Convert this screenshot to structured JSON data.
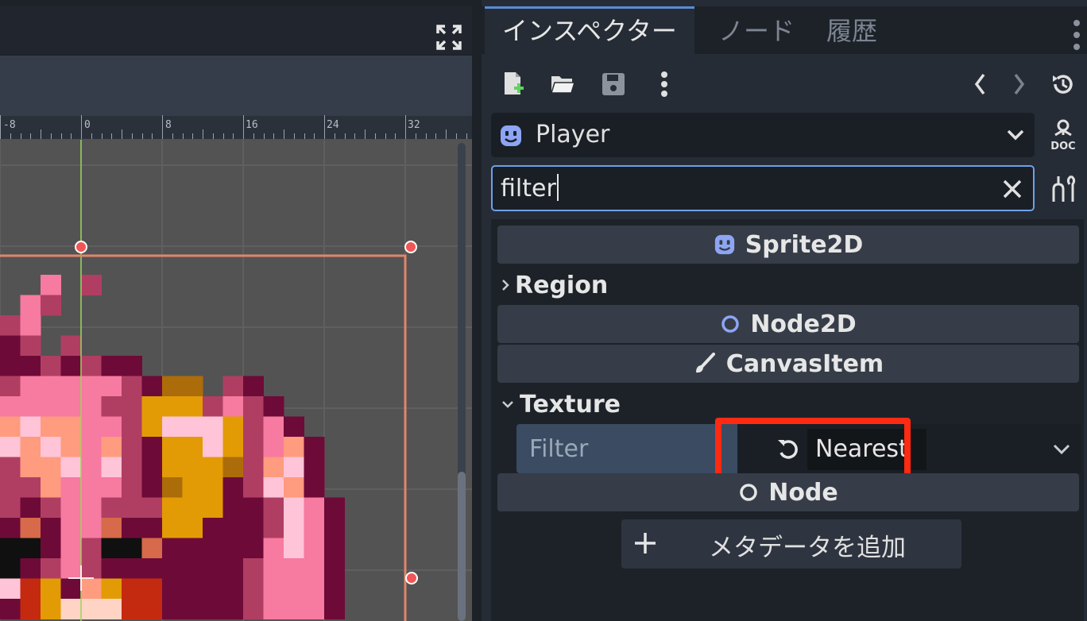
{
  "viewport": {
    "ruler_labels": [
      "-8",
      "0",
      "8",
      "16",
      "24",
      "32"
    ]
  },
  "tabs": [
    {
      "label": "インスペクター",
      "active": true
    },
    {
      "label": "ノード",
      "active": false
    },
    {
      "label": "履歴",
      "active": false
    }
  ],
  "toolbar": {
    "icons": [
      "new-resource-icon",
      "open-folder-icon",
      "save-icon",
      "more-vertical-icon",
      "history-back-icon",
      "history-forward-icon",
      "object-history-icon"
    ]
  },
  "object_selector": {
    "name": "Player",
    "icon": "sprite2d-icon"
  },
  "filter_input": {
    "value": "filter"
  },
  "sections": {
    "sprite2d": "Sprite2D",
    "region": "Region",
    "node2d": "Node2D",
    "canvasitem": "CanvasItem",
    "texture": "Texture",
    "node": "Node"
  },
  "property": {
    "label": "Filter",
    "value": "Nearest"
  },
  "add_metadata": {
    "label": "メタデータを追加"
  },
  "colors": {
    "accent_blue": "#6ea0e6",
    "highlight_red": "#ff2a12",
    "sprite_icon": "#8da5f3"
  }
}
